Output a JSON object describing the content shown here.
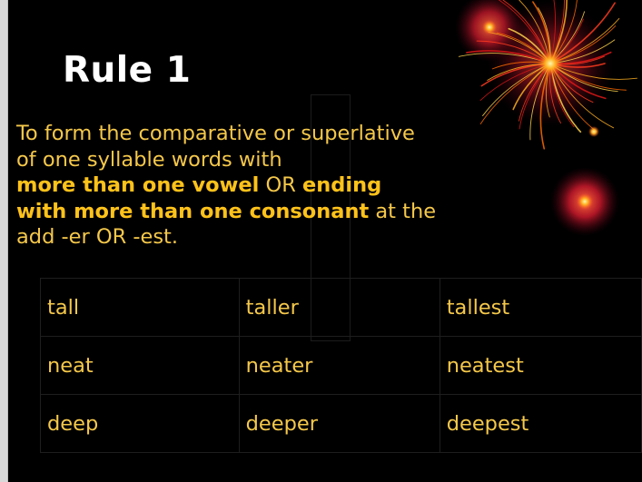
{
  "slide": {
    "title": "Rule 1",
    "lines": [
      [
        {
          "t": "To form the comparative or superlative",
          "bold": false
        }
      ],
      [
        {
          "t": "of one syllable words with",
          "bold": false
        }
      ],
      [
        {
          "t": "more than one vowel",
          "bold": true
        },
        {
          "t": " OR ",
          "bold": false
        },
        {
          "t": "ending",
          "bold": true
        }
      ],
      [
        {
          "t": "with more than one consonant",
          "bold": true
        },
        {
          "t": " at the",
          "bold": false
        }
      ],
      [
        {
          "t": "add -er OR -est.",
          "bold": false
        }
      ]
    ],
    "table": [
      [
        "tall",
        "taller",
        "tallest"
      ],
      [
        "neat",
        "neater",
        "neatest"
      ],
      [
        "deep",
        "deeper",
        "deepest"
      ]
    ]
  },
  "colors": {
    "background": "#000000",
    "text": "#f5c84a",
    "title": "#ffffff"
  },
  "decoration": {
    "icon": "firework-icon"
  }
}
